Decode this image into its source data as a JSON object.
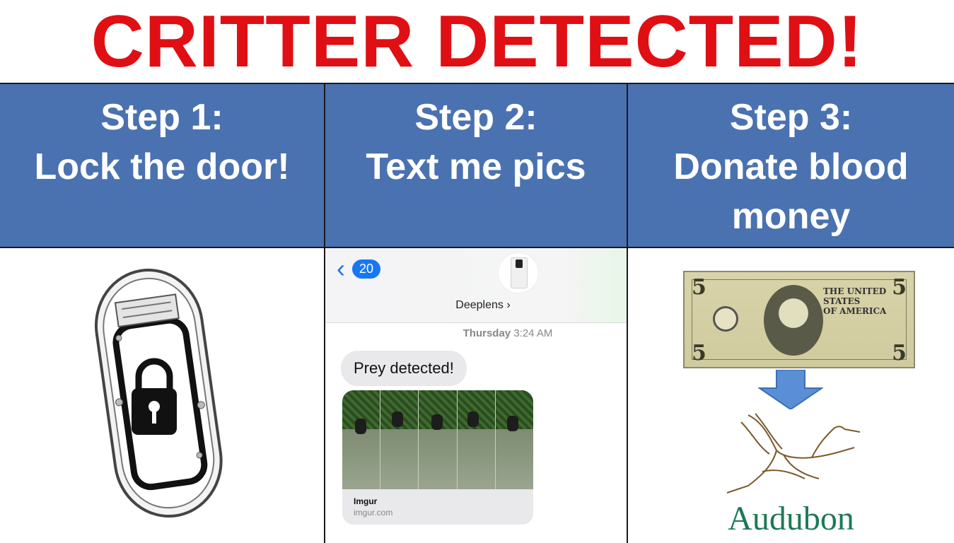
{
  "title": "CRITTER DETECTED!",
  "steps": [
    {
      "label": "Step 1:",
      "text": "Lock the door!"
    },
    {
      "label": "Step 2:",
      "text": "Text me pics"
    },
    {
      "label": "Step 3:",
      "text_line1": "Donate blood",
      "text_line2": "money"
    }
  ],
  "step1": {
    "icon": "lock-icon"
  },
  "step2": {
    "badge_count": "20",
    "contact_name": "Deeplens",
    "timestamp_day": "Thursday",
    "timestamp_time": "3:24 AM",
    "message": "Prey detected!",
    "media_title": "Imgur",
    "media_domain": "imgur.com"
  },
  "step3": {
    "logo_text": "Audubon",
    "colors": {
      "logo": "#1c7a54",
      "arrow": "#5a8fd6"
    }
  },
  "colors": {
    "title": "#e00f14",
    "header_bg": "#4a72b0",
    "link_blue": "#1877f2"
  }
}
